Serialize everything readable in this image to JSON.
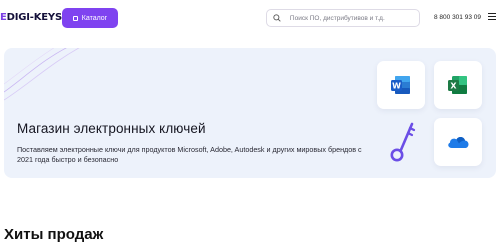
{
  "header": {
    "logo_mark": "E",
    "logo_text": "DIGI-KEYS",
    "catalog_label": "Каталог",
    "search_placeholder": "Поиск ПО, дистрибутивов и т.д.",
    "phone": "8 800 301 93 09"
  },
  "hero": {
    "title": "Магазин электронных ключей",
    "description": "Поставляем электронные ключи для продуктов Microsoft, Adobe, Autodesk и других мировых брендов с 2021 года быстро и безопасно",
    "word_letter": "W",
    "excel_letter": "X"
  },
  "sections": {
    "hits_title": "Хиты продаж"
  },
  "colors": {
    "accent": "#7f43f0",
    "hero_bg": "#edf2fb",
    "word": "#1a5dc9",
    "excel": "#1d7a45",
    "onedrive": "#1e7be8"
  },
  "icons": [
    "catalog-icon",
    "search-icon",
    "menu-icon",
    "word-icon",
    "excel-icon",
    "key-icon",
    "onedrive-icon"
  ]
}
